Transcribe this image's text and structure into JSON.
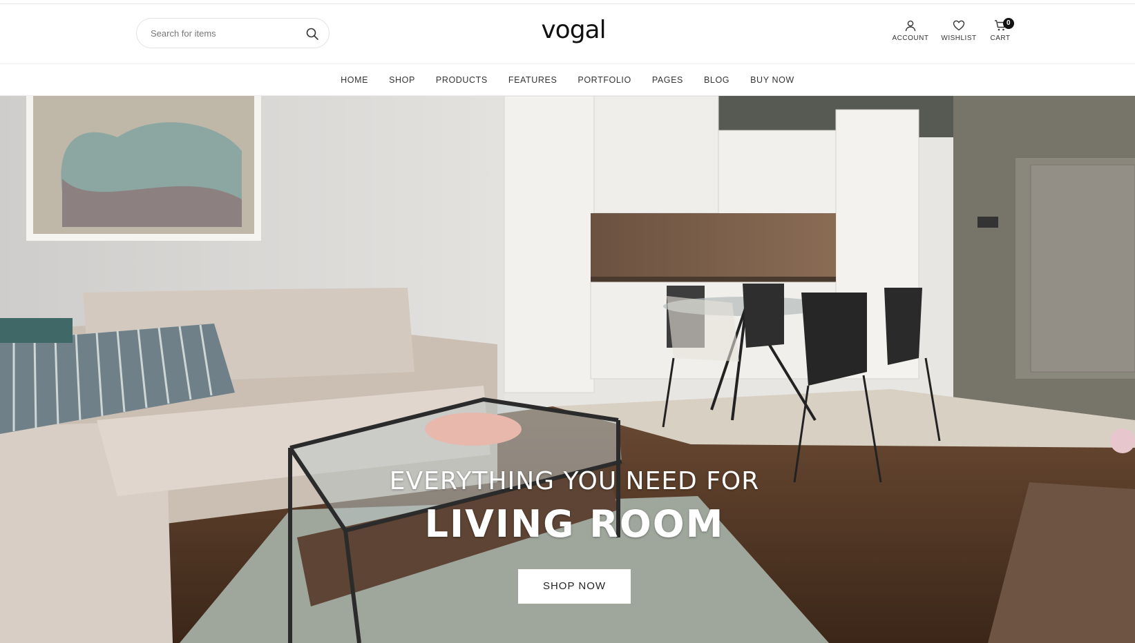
{
  "search": {
    "placeholder": "Search for items"
  },
  "logo": "vogal",
  "header_icons": {
    "account_label": "ACCOUNT",
    "wishlist_label": "WISHLIST",
    "cart_label": "CART",
    "cart_count": "0"
  },
  "nav": {
    "items": [
      "HOME",
      "SHOP",
      "PRODUCTS",
      "FEATURES",
      "PORTFOLIO",
      "PAGES",
      "BLOG",
      "BUY NOW"
    ]
  },
  "hero": {
    "subtitle": "EVERYTHING YOU NEED FOR",
    "title": "LIVING ROOM",
    "button_label": "SHOP NOW"
  },
  "colors": {
    "accent": "#111111",
    "background": "#ffffff"
  }
}
